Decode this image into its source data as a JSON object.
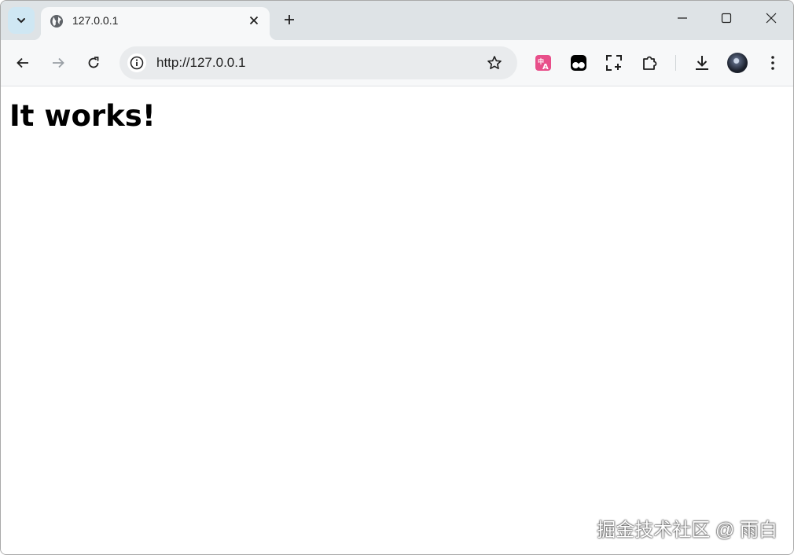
{
  "tab": {
    "title": "127.0.0.1",
    "favicon": "globe-icon"
  },
  "toolbar": {
    "url": "http://127.0.0.1",
    "extensions": [
      "translate-extension-icon",
      "tampermonkey-icon",
      "screenshot-icon",
      "extensions-puzzle-icon"
    ]
  },
  "page": {
    "heading": "It works!"
  },
  "watermark": "掘金技术社区 @ 雨白",
  "colors": {
    "tabstrip": "#dee3e6",
    "toolbar": "#f7f8f9",
    "omnibox": "#e9ebed",
    "translate_ext": "#e84f8a"
  }
}
